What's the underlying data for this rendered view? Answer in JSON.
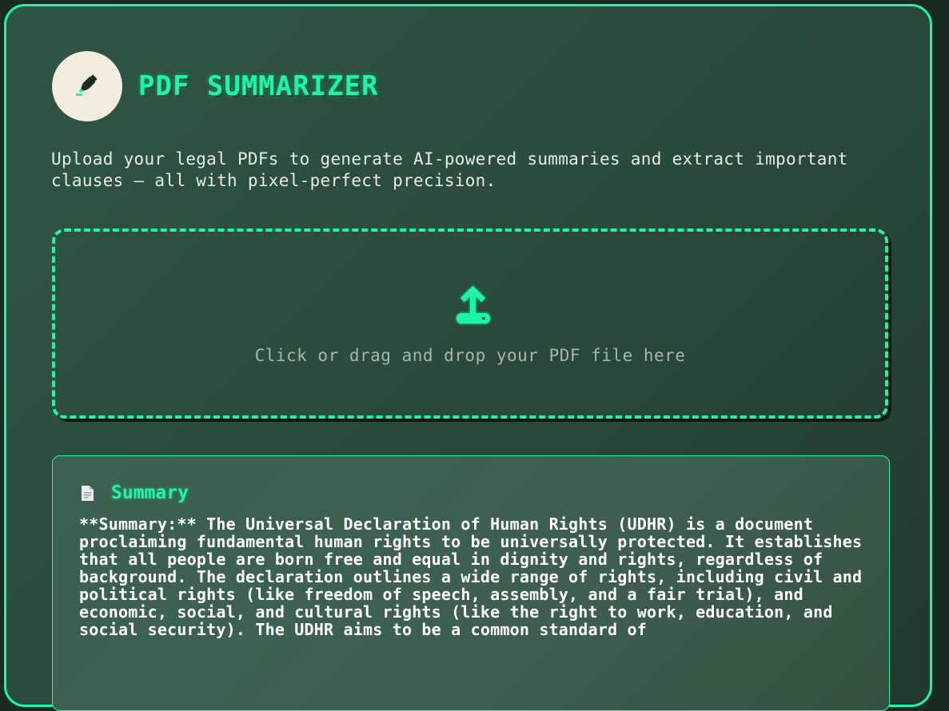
{
  "app": {
    "title": "PDF SUMMARIZER",
    "logo_icon": "highlighter-icon",
    "subtitle": "Upload your legal PDFs to generate AI-powered summaries and extract important clauses — all with pixel-perfect precision."
  },
  "upload": {
    "icon": "upload-icon",
    "label": "Click or drag and drop your PDF file here"
  },
  "summary": {
    "icon": "document-icon",
    "title": "Summary",
    "text": "**Summary:** The Universal Declaration of Human Rights (UDHR) is a document proclaiming fundamental human rights to be universally protected. It establishes that all people are born free and equal in dignity and rights, regardless of background. The declaration outlines a wide range of rights, including civil and political rights (like freedom of speech, assembly, and a fair trial), and economic, social, and cultural rights (like the right to work, education, and social security). The UDHR aims to be a common standard of"
  },
  "colors": {
    "accent": "#1ff5a8",
    "background": "#2a4a3d",
    "logo_bg": "#f3eddf"
  }
}
